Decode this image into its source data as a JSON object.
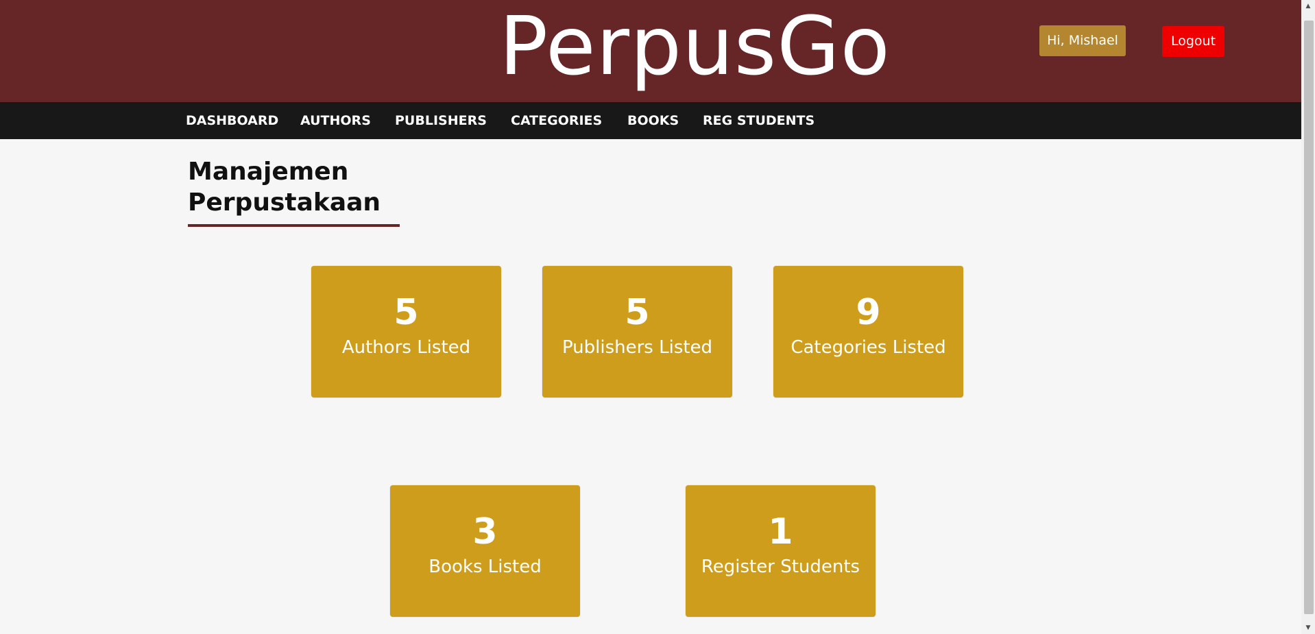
{
  "header": {
    "logo": "PerpusGo",
    "greeting": "Hi, Mishael",
    "logout": "Logout"
  },
  "nav": {
    "items": [
      {
        "label": "DASHBOARD"
      },
      {
        "label": "AUTHORS"
      },
      {
        "label": "PUBLISHERS"
      },
      {
        "label": "CATEGORIES"
      },
      {
        "label": "BOOKS"
      },
      {
        "label": "REG STUDENTS"
      }
    ]
  },
  "main": {
    "title_line1": "Manajemen",
    "title_line2": "Perpustakaan",
    "cards": [
      {
        "value": "5",
        "label": "Authors Listed"
      },
      {
        "value": "5",
        "label": "Publishers Listed"
      },
      {
        "value": "9",
        "label": "Categories Listed"
      },
      {
        "value": "3",
        "label": "Books Listed"
      },
      {
        "value": "1",
        "label": "Register Students"
      }
    ]
  },
  "scrollbar": {
    "up_icon": "triangle-up",
    "down_icon": "triangle-down"
  },
  "colors": {
    "header": "#662627",
    "nav": "#181818",
    "card": "#ce9d1c",
    "greeting": "#b48630",
    "logout": "#ee0000",
    "background": "#f6f6f6"
  }
}
